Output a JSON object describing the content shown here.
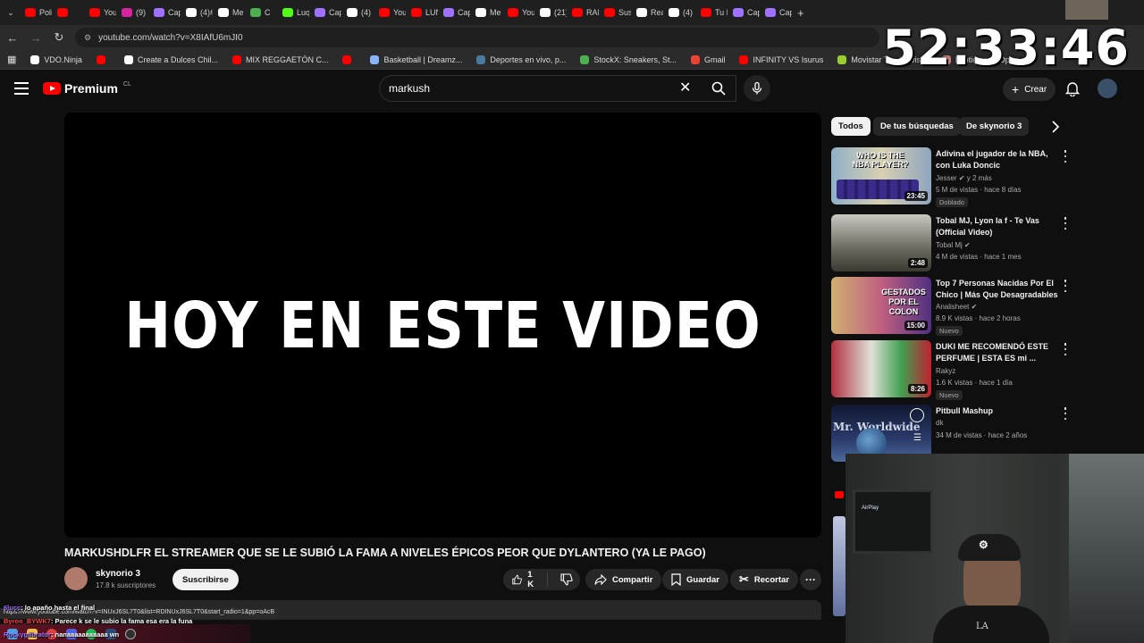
{
  "browser": {
    "tabs": [
      {
        "label": "Poli",
        "color": "#ff0000"
      },
      {
        "label": "",
        "color": "#ff0000"
      },
      {
        "label": "You",
        "color": "#ff0000"
      },
      {
        "label": "(9) I",
        "color": "#d6249f"
      },
      {
        "label": "Cap",
        "color": "#a070ff"
      },
      {
        "label": "(4)#",
        "color": "#ffffff"
      },
      {
        "label": "Me",
        "color": "#ffffff"
      },
      {
        "label": "C",
        "color": "#4caf50"
      },
      {
        "label": "Luq",
        "color": "#53fc18"
      },
      {
        "label": "Cap",
        "color": "#a070ff"
      },
      {
        "label": "(4)",
        "color": "#ffffff"
      },
      {
        "label": "You",
        "color": "#ff0000"
      },
      {
        "label": "LUN",
        "color": "#ff0000"
      },
      {
        "label": "Cap",
        "color": "#a070ff"
      },
      {
        "label": "Me",
        "color": "#ffffff"
      },
      {
        "label": "You",
        "color": "#ff0000"
      },
      {
        "label": "(21)",
        "color": "#ffffff"
      },
      {
        "label": "RAI",
        "color": "#ff0000"
      },
      {
        "label": "Sus",
        "color": "#ff0000"
      },
      {
        "label": "Rea",
        "color": "#ffffff"
      },
      {
        "label": "(4)",
        "color": "#ffffff"
      },
      {
        "label": "Tu I",
        "color": "#ff0000"
      },
      {
        "label": "Cap",
        "color": "#a070ff"
      },
      {
        "label": "Cap",
        "color": "#a070ff"
      }
    ],
    "url": "youtube.com/watch?v=X8IAfU6mJI0",
    "bookmarks": [
      {
        "label": "VDO.Ninja",
        "color": "#ffffff"
      },
      {
        "label": "",
        "color": "#ff0000"
      },
      {
        "label": "Create a Dulces Chil...",
        "color": "#ffffff"
      },
      {
        "label": "MIX REGGAETÓN C...",
        "color": "#ff0000"
      },
      {
        "label": "",
        "color": "#ff0000"
      },
      {
        "label": "Basketball | Dreamz...",
        "color": "#8ab4f8"
      },
      {
        "label": "Deportes en vivo, p...",
        "color": "#4a7aa0"
      },
      {
        "label": "StockX: Sneakers, St...",
        "color": "#4caf50"
      },
      {
        "label": "Gmail",
        "color": "#ea4335"
      },
      {
        "label": "INFINITY VS Isurus",
        "color": "#ff0000"
      },
      {
        "label": "Movistar Tv - Movis...",
        "color": "#9acd32"
      },
      {
        "label": "Lootie.com: Open...",
        "color": "#c08080"
      }
    ]
  },
  "timer": "52:33:46",
  "youtube": {
    "logo": "Premium",
    "logo_region": "CL",
    "search_value": "markush",
    "create_label": "Crear"
  },
  "video": {
    "overlay_text": "HOY EN ESTE VIDEO",
    "title": "MARKUSHDLFR EL STREAMER QUE SE LE SUBIÓ LA FAMA A NIVELES ÉPICOS PEOR QUE DYLANTERO (YA LE PAGO)",
    "channel": "skynorio 3",
    "subscribers": "17.8 k suscriptores",
    "subscribe_label": "Suscribirse",
    "likes": "1 K",
    "share_label": "Compartir",
    "save_label": "Guardar",
    "clip_label": "Recortar"
  },
  "chips": [
    {
      "label": "Todos",
      "active": true
    },
    {
      "label": "De tus búsquedas",
      "active": false
    },
    {
      "label": "De skynorio 3",
      "active": false
    }
  ],
  "recommendations": [
    {
      "title": "Adivina el jugador de la NBA, con Luka Doncic",
      "channel": "Jesser",
      "meta": "5 M de vistas · hace 8 días",
      "extra": "y 2 más",
      "badge": "Doblado",
      "duration": "23:45",
      "thumb_text": "WHO IS THE NBA PLAYER?"
    },
    {
      "title": "Tobal MJ, Lyon la f - Te Vas (Official Video)",
      "channel": "Tobal Mj",
      "meta": "4 M de vistas · hace 1 mes",
      "extra": "",
      "badge": "",
      "duration": "2:48",
      "thumb_text": ""
    },
    {
      "title": "Top 7 Personas Nacidas Por El Chico | Más Que Desagradables",
      "channel": "Analisheet",
      "meta": "8.9 K vistas · hace 2 horas",
      "extra": "",
      "badge": "Nuevo",
      "duration": "15:00",
      "thumb_text": "GESTADOS POR EL COLON"
    },
    {
      "title": "DUKI ME RECOMENDÓ ESTE PERFUME | ESTA ES mi ...",
      "channel": "Rakyz",
      "meta": "1.6 K vistas · hace 1 día",
      "extra": "",
      "badge": "Nuevo",
      "duration": "8:26",
      "thumb_text": ""
    },
    {
      "title": "Pitbull Mashup",
      "channel": "dk",
      "meta": "34 M de vistas · hace 2 años",
      "extra": "",
      "badge": "",
      "duration": "",
      "thumb_text": "Mr. Worldwide"
    }
  ],
  "status_url": "https://www.youtube.com/watch?v=INUxJ6SL7T0&list=RDINUxJ6SL7T0&start_radio=1&pp=oAcB",
  "chat": [
    {
      "user": "6lucc",
      "text": ": lo apaño hasta el final",
      "color": "#a070ff"
    },
    {
      "user": "Byron_BYWK7",
      "text": ": Parece k se le subio la fama esa era la funa",
      "color": "#ff4040"
    },
    {
      "user": "Rockygilbrator",
      "text": ": nanaaaaaaaaaaa wn",
      "color": "#a070ff"
    }
  ],
  "webcam": {
    "airplay_label": "AirPlay",
    "cap_text": "LA"
  }
}
